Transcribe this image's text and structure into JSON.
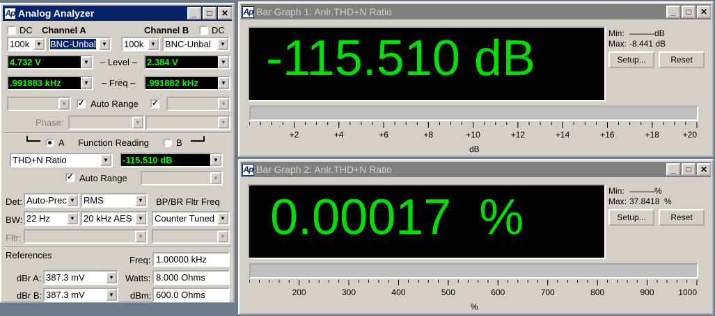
{
  "analyzer": {
    "title": "Analog Analyzer",
    "channel_a_label": "Channel A",
    "channel_b_label": "Channel B",
    "dc_label": "DC",
    "ch_a_imp": "100k",
    "ch_a_conn": "BNC-Unbal",
    "ch_b_imp": "100k",
    "ch_b_conn": "BNC-Unbal",
    "level_label": "– Level –",
    "level_a": "4.732   V",
    "level_b": "2.384   V",
    "freq_label": "– Freq –",
    "freq_a": ".991883 kHz",
    "freq_b": ".991882 kHz",
    "auto_range": "Auto Range",
    "phase_label": "Phase:",
    "radio_a": "A",
    "radio_b": "B",
    "function_reading": "Function Reading",
    "function": "THD+N Ratio",
    "function_value": "-115.510 dB",
    "auto_range2": "Auto Range",
    "det_label": "Det:",
    "det_value": "Auto-Prec",
    "rms_value": "RMS",
    "bp_label": "BP/BR Fltr Freq",
    "bw_label": "BW:",
    "bw_low": "22 Hz",
    "bw_high": "20 kHz AES",
    "counter_tuned": "Counter Tuned",
    "fltr_label": "Fltr:",
    "references_label": "References",
    "ref_freq_label": "Freq:",
    "ref_freq_value": "1.00000 kHz",
    "dbra_label": "dBr A:",
    "dbra_value": "387.3   mV",
    "watts_label": "Watts:",
    "watts_value": "8.000    Ohms",
    "dbrb_label": "dBr B:",
    "dbrb_value": "387.3   mV",
    "dbm_label": "dBm:",
    "dbm_value": "600.0    Ohms"
  },
  "graph1": {
    "title": "Bar Graph 1: Anlr.THD+N Ratio",
    "reading": "-115.510 dB",
    "min_label": "Min:",
    "min_value": "———dB",
    "max_label": "Max:",
    "max_value": "-8.441   dB",
    "setup": "Setup...",
    "reset": "Reset",
    "ticks": [
      "+2",
      "+4",
      "+6",
      "+8",
      "+10",
      "+12",
      "+14",
      "+16",
      "+18",
      "+20"
    ],
    "unit": "dB"
  },
  "graph2": {
    "title": "Bar Graph 2: Anlr.THD+N Ratio",
    "reading": "0.00017  %",
    "min_label": "Min:",
    "min_value": "———%",
    "max_label": "Max:",
    "max_value": "37.8418  %",
    "setup": "Setup...",
    "reset": "Reset",
    "ticks": [
      "200",
      "300",
      "400",
      "500",
      "600",
      "700",
      "800",
      "900",
      "1000"
    ],
    "unit": "%"
  },
  "colors": {
    "reading_green": "#00e000",
    "active_title": "#0a246a",
    "inactive_title": "#808080"
  }
}
